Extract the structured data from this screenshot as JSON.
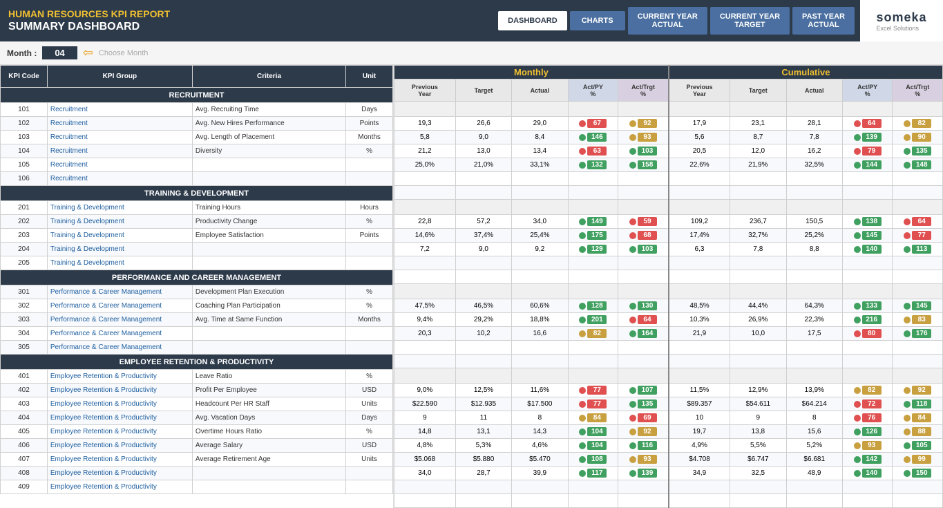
{
  "header": {
    "main_title": "HUMAN RESOURCES KPI REPORT",
    "sub_title": "SUMMARY DASHBOARD",
    "nav": {
      "dashboard": "DASHBOARD",
      "charts": "CHARTS",
      "current_year_actual": "CURRENT YEAR ACTUAL",
      "current_year_target": "CURRENT YEAR TARGET",
      "past_year_actual": "PAST YEAR ACTUAL"
    },
    "logo_text": "someka",
    "logo_sub": "Excel Solutions"
  },
  "month_bar": {
    "label": "Month :",
    "value": "04",
    "hint": "Choose Month"
  },
  "kpi_columns": {
    "code": "KPI Code",
    "group": "KPI Group",
    "criteria": "Criteria",
    "unit": "Unit"
  },
  "monthly_label": "Monthly",
  "cumulative_label": "Cumulative",
  "data_columns": [
    "Previous Year",
    "Target",
    "Actual",
    "Act/PY %",
    "Act/Trgt %"
  ],
  "sections": [
    {
      "title": "RECRUITMENT",
      "rows": [
        {
          "code": "101",
          "group": "Recruitment",
          "criteria": "Avg. Recruiting Time",
          "unit": "Days",
          "m_prev": "19,3",
          "m_tgt": "26,6",
          "m_act": "29,0",
          "m_actpy": "67",
          "m_actpy_dot": "red",
          "m_acttrgt": "92",
          "m_acttrgt_dot": "orange",
          "c_prev": "17,9",
          "c_tgt": "23,1",
          "c_act": "28,1",
          "c_actpy": "64",
          "c_actpy_dot": "red",
          "c_acttrgt": "82",
          "c_acttrgt_dot": "orange"
        },
        {
          "code": "102",
          "group": "Recruitment",
          "criteria": "Avg. New Hires Performance",
          "unit": "Points",
          "m_prev": "5,8",
          "m_tgt": "9,0",
          "m_act": "8,4",
          "m_actpy": "146",
          "m_actpy_dot": "green",
          "m_acttrgt": "93",
          "m_acttrgt_dot": "orange",
          "c_prev": "5,6",
          "c_tgt": "8,7",
          "c_act": "7,8",
          "c_actpy": "139",
          "c_actpy_dot": "green",
          "c_acttrgt": "90",
          "c_acttrgt_dot": "orange"
        },
        {
          "code": "103",
          "group": "Recruitment",
          "criteria": "Avg. Length of Placement",
          "unit": "Months",
          "m_prev": "21,2",
          "m_tgt": "13,0",
          "m_act": "13,4",
          "m_actpy": "63",
          "m_actpy_dot": "red",
          "m_acttrgt": "103",
          "m_acttrgt_dot": "green",
          "c_prev": "20,5",
          "c_tgt": "12,0",
          "c_act": "16,2",
          "c_actpy": "79",
          "c_actpy_dot": "red",
          "c_acttrgt": "135",
          "c_acttrgt_dot": "green"
        },
        {
          "code": "104",
          "group": "Recruitment",
          "criteria": "Diversity",
          "unit": "%",
          "m_prev": "25,0%",
          "m_tgt": "21,0%",
          "m_act": "33,1%",
          "m_actpy": "132",
          "m_actpy_dot": "green",
          "m_acttrgt": "158",
          "m_acttrgt_dot": "green",
          "c_prev": "22,6%",
          "c_tgt": "21,9%",
          "c_act": "32,5%",
          "c_actpy": "144",
          "c_actpy_dot": "green",
          "c_acttrgt": "148",
          "c_acttrgt_dot": "green"
        },
        {
          "code": "105",
          "group": "Recruitment",
          "criteria": "",
          "unit": "",
          "empty": true
        },
        {
          "code": "106",
          "group": "Recruitment",
          "criteria": "",
          "unit": "",
          "empty": true
        }
      ]
    },
    {
      "title": "TRAINING & DEVELOPMENT",
      "rows": [
        {
          "code": "201",
          "group": "Training & Development",
          "criteria": "Training Hours",
          "unit": "Hours",
          "m_prev": "22,8",
          "m_tgt": "57,2",
          "m_act": "34,0",
          "m_actpy": "149",
          "m_actpy_dot": "green",
          "m_acttrgt": "59",
          "m_acttrgt_dot": "red",
          "c_prev": "109,2",
          "c_tgt": "236,7",
          "c_act": "150,5",
          "c_actpy": "138",
          "c_actpy_dot": "green",
          "c_acttrgt": "64",
          "c_acttrgt_dot": "red"
        },
        {
          "code": "202",
          "group": "Training & Development",
          "criteria": "Productivity Change",
          "unit": "%",
          "m_prev": "14,6%",
          "m_tgt": "37,4%",
          "m_act": "25,4%",
          "m_actpy": "175",
          "m_actpy_dot": "green",
          "m_acttrgt": "68",
          "m_acttrgt_dot": "red",
          "c_prev": "17,4%",
          "c_tgt": "32,7%",
          "c_act": "25,2%",
          "c_actpy": "145",
          "c_actpy_dot": "green",
          "c_acttrgt": "77",
          "c_acttrgt_dot": "red"
        },
        {
          "code": "203",
          "group": "Training & Development",
          "criteria": "Employee Satisfaction",
          "unit": "Points",
          "m_prev": "7,2",
          "m_tgt": "9,0",
          "m_act": "9,2",
          "m_actpy": "129",
          "m_actpy_dot": "green",
          "m_acttrgt": "103",
          "m_acttrgt_dot": "green",
          "c_prev": "6,3",
          "c_tgt": "7,8",
          "c_act": "8,8",
          "c_actpy": "140",
          "c_actpy_dot": "green",
          "c_acttrgt": "113",
          "c_acttrgt_dot": "green"
        },
        {
          "code": "204",
          "group": "Training & Development",
          "criteria": "",
          "unit": "",
          "empty": true
        },
        {
          "code": "205",
          "group": "Training & Development",
          "criteria": "",
          "unit": "",
          "empty": true
        }
      ]
    },
    {
      "title": "PERFORMANCE AND CAREER MANAGEMENT",
      "rows": [
        {
          "code": "301",
          "group": "Performance & Career Management",
          "criteria": "Development Plan Execution",
          "unit": "%",
          "m_prev": "47,5%",
          "m_tgt": "46,5%",
          "m_act": "60,6%",
          "m_actpy": "128",
          "m_actpy_dot": "green",
          "m_acttrgt": "130",
          "m_acttrgt_dot": "green",
          "c_prev": "48,5%",
          "c_tgt": "44,4%",
          "c_act": "64,3%",
          "c_actpy": "133",
          "c_actpy_dot": "green",
          "c_acttrgt": "145",
          "c_acttrgt_dot": "green"
        },
        {
          "code": "302",
          "group": "Performance & Career Management",
          "criteria": "Coaching Plan Participation",
          "unit": "%",
          "m_prev": "9,4%",
          "m_tgt": "29,2%",
          "m_act": "18,8%",
          "m_actpy": "201",
          "m_actpy_dot": "green",
          "m_acttrgt": "64",
          "m_acttrgt_dot": "red",
          "c_prev": "10,3%",
          "c_tgt": "26,9%",
          "c_act": "22,3%",
          "c_actpy": "216",
          "c_actpy_dot": "green",
          "c_acttrgt": "83",
          "c_acttrgt_dot": "orange"
        },
        {
          "code": "303",
          "group": "Performance & Career Management",
          "criteria": "Avg. Time at Same Function",
          "unit": "Months",
          "m_prev": "20,3",
          "m_tgt": "10,2",
          "m_act": "16,6",
          "m_actpy": "82",
          "m_actpy_dot": "orange",
          "m_acttrgt": "164",
          "m_acttrgt_dot": "green",
          "c_prev": "21,9",
          "c_tgt": "10,0",
          "c_act": "17,5",
          "c_actpy": "80",
          "c_actpy_dot": "red",
          "c_acttrgt": "176",
          "c_acttrgt_dot": "green"
        },
        {
          "code": "304",
          "group": "Performance & Career Management",
          "criteria": "",
          "unit": "",
          "empty": true
        },
        {
          "code": "305",
          "group": "Performance & Career Management",
          "criteria": "",
          "unit": "",
          "empty": true
        }
      ]
    },
    {
      "title": "EMPLOYEE RETENTION & PRODUCTIVITY",
      "rows": [
        {
          "code": "401",
          "group": "Employee Retention & Productivity",
          "criteria": "Leave Ratio",
          "unit": "%",
          "m_prev": "9,0%",
          "m_tgt": "12,5%",
          "m_act": "11,6%",
          "m_actpy": "77",
          "m_actpy_dot": "red",
          "m_acttrgt": "107",
          "m_acttrgt_dot": "green",
          "c_prev": "11,5%",
          "c_tgt": "12,9%",
          "c_act": "13,9%",
          "c_actpy": "82",
          "c_actpy_dot": "orange",
          "c_acttrgt": "92",
          "c_acttrgt_dot": "orange"
        },
        {
          "code": "402",
          "group": "Employee Retention & Productivity",
          "criteria": "Profit Per Employee",
          "unit": "USD",
          "m_prev": "$22.590",
          "m_tgt": "$12.935",
          "m_act": "$17.500",
          "m_actpy": "77",
          "m_actpy_dot": "red",
          "m_acttrgt": "135",
          "m_acttrgt_dot": "green",
          "c_prev": "$89.357",
          "c_tgt": "$54.611",
          "c_act": "$64.214",
          "c_actpy": "72",
          "c_actpy_dot": "red",
          "c_acttrgt": "118",
          "c_acttrgt_dot": "green"
        },
        {
          "code": "403",
          "group": "Employee Retention & Productivity",
          "criteria": "Headcount Per HR Staff",
          "unit": "Units",
          "m_prev": "9",
          "m_tgt": "11",
          "m_act": "8",
          "m_actpy": "84",
          "m_actpy_dot": "orange",
          "m_acttrgt": "69",
          "m_acttrgt_dot": "red",
          "c_prev": "10",
          "c_tgt": "9",
          "c_act": "8",
          "c_actpy": "76",
          "c_actpy_dot": "red",
          "c_acttrgt": "84",
          "c_acttrgt_dot": "orange"
        },
        {
          "code": "404",
          "group": "Employee Retention & Productivity",
          "criteria": "Avg. Vacation Days",
          "unit": "Days",
          "m_prev": "14,8",
          "m_tgt": "13,1",
          "m_act": "14,3",
          "m_actpy": "104",
          "m_actpy_dot": "green",
          "m_acttrgt": "92",
          "m_acttrgt_dot": "orange",
          "c_prev": "19,7",
          "c_tgt": "13,8",
          "c_act": "15,6",
          "c_actpy": "126",
          "c_actpy_dot": "green",
          "c_acttrgt": "88",
          "c_acttrgt_dot": "orange"
        },
        {
          "code": "405",
          "group": "Employee Retention & Productivity",
          "criteria": "Overtime Hours Ratio",
          "unit": "%",
          "m_prev": "4,8%",
          "m_tgt": "5,3%",
          "m_act": "4,6%",
          "m_actpy": "104",
          "m_actpy_dot": "green",
          "m_acttrgt": "116",
          "m_acttrgt_dot": "green",
          "c_prev": "4,9%",
          "c_tgt": "5,5%",
          "c_act": "5,2%",
          "c_actpy": "93",
          "c_actpy_dot": "orange",
          "c_acttrgt": "105",
          "c_acttrgt_dot": "green"
        },
        {
          "code": "406",
          "group": "Employee Retention & Productivity",
          "criteria": "Average Salary",
          "unit": "USD",
          "m_prev": "$5.068",
          "m_tgt": "$5.880",
          "m_act": "$5.470",
          "m_actpy": "108",
          "m_actpy_dot": "green",
          "m_acttrgt": "93",
          "m_acttrgt_dot": "orange",
          "c_prev": "$4.708",
          "c_tgt": "$6.747",
          "c_act": "$6.681",
          "c_actpy": "142",
          "c_actpy_dot": "green",
          "c_acttrgt": "99",
          "c_acttrgt_dot": "orange"
        },
        {
          "code": "407",
          "group": "Employee Retention & Productivity",
          "criteria": "Average Retirement Age",
          "unit": "Units",
          "m_prev": "34,0",
          "m_tgt": "28,7",
          "m_act": "39,9",
          "m_actpy": "117",
          "m_actpy_dot": "green",
          "m_acttrgt": "139",
          "m_acttrgt_dot": "green",
          "c_prev": "34,9",
          "c_tgt": "32,5",
          "c_act": "48,9",
          "c_actpy": "140",
          "c_actpy_dot": "green",
          "c_acttrgt": "150",
          "c_acttrgt_dot": "green"
        },
        {
          "code": "408",
          "group": "Employee Retention & Productivity",
          "criteria": "",
          "unit": "",
          "empty": true
        },
        {
          "code": "409",
          "group": "Employee Retention & Productivity",
          "criteria": "",
          "unit": "",
          "empty": true
        }
      ]
    }
  ]
}
